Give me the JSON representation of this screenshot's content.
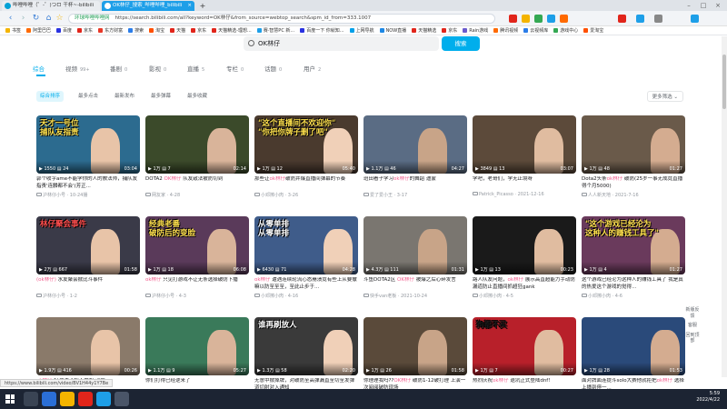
{
  "browser": {
    "tabs": [
      {
        "label": "哔哩哔哩（゜-゜)つロ 干杯~-bilibili",
        "active": false
      },
      {
        "label": "OK林仔_搜索_哔哩哔哩_bilibili",
        "active": true
      }
    ],
    "new_tab_symbol": "+",
    "address": {
      "site_label": "环球哔哩哔哩网",
      "url": "https://search.bilibili.com/all?keyword=OK林仔&from_source=webtop_search&spm_id_from=333.1007"
    },
    "bookmarks": [
      {
        "label": "书签",
        "color": "#f4b400"
      },
      {
        "label": "阿里巴巴",
        "color": "#ff6a00"
      },
      {
        "label": "百度",
        "color": "#2932e1"
      },
      {
        "label": "京东",
        "color": "#e1251b"
      },
      {
        "label": "东方财富",
        "color": "#e83828"
      },
      {
        "label": "搜索",
        "color": "#2b7de9"
      },
      {
        "label": "淘宝",
        "color": "#ff5000"
      },
      {
        "label": "天猫",
        "color": "#e1251b"
      },
      {
        "label": "京东",
        "color": "#e1251b"
      },
      {
        "label": "天猫精选-理想...",
        "color": "#e1251b"
      },
      {
        "label": "赛·智慧PC 新...",
        "color": "#1e9fe8"
      },
      {
        "label": "百度一下 你就知...",
        "color": "#2932e1"
      },
      {
        "label": "上网导航",
        "color": "#00a0e9"
      },
      {
        "label": "NOW直播",
        "color": "#1e88e5"
      },
      {
        "label": "天猫精选",
        "color": "#e1251b"
      },
      {
        "label": "京东",
        "color": "#e1251b"
      },
      {
        "label": "Rain游戏",
        "color": "#6a5acd"
      },
      {
        "label": "腾讯视频",
        "color": "#ff6a00"
      },
      {
        "label": "云视频库",
        "color": "#2b7de9"
      },
      {
        "label": "游戏中心",
        "color": "#34a853"
      },
      {
        "label": "爱淘宝",
        "color": "#ff5000"
      }
    ],
    "status_url": "https://www.bilibili.com/video/BV1H44y1Y7Be"
  },
  "search": {
    "query": "OK林仔",
    "button_label": "搜索"
  },
  "type_tabs": [
    {
      "label": "综合",
      "count": "",
      "active": true
    },
    {
      "label": "视频",
      "count": "99+",
      "active": false
    },
    {
      "label": "番剧",
      "count": "0",
      "active": false
    },
    {
      "label": "影视",
      "count": "0",
      "active": false
    },
    {
      "label": "直播",
      "count": "5",
      "active": false
    },
    {
      "label": "专栏",
      "count": "0",
      "active": false
    },
    {
      "label": "话题",
      "count": "0",
      "active": false
    },
    {
      "label": "用户",
      "count": "2",
      "active": false
    }
  ],
  "sort_options": [
    {
      "label": "综合排序",
      "active": true
    },
    {
      "label": "最多点击",
      "active": false
    },
    {
      "label": "最新发布",
      "active": false
    },
    {
      "label": "最多弹幕",
      "active": false
    },
    {
      "label": "最多收藏",
      "active": false
    }
  ],
  "more_filter_label": "更多筛选",
  "videos": [
    {
      "title_pre": "郭个收字ame不能学你的人的教法师，捕队友指责'连麟都不会'(芳正...",
      "hl": "",
      "title_post": "",
      "author": "沪林仔小号",
      "date": "10-24播",
      "views": "1550",
      "danmaku": "24",
      "duration": "03:04",
      "caption": "天才一号位\n捕队友指责",
      "bg": "#2c6b8f",
      "cap_color": "#ffe14d"
    },
    {
      "title_pre": "DOTA2 ",
      "hl": "OK林仔",
      "title_post": " 队友敌法被防切到",
      "author": "网友家",
      "date": "4-28",
      "views": "1万",
      "danmaku": "7",
      "duration": "02:14",
      "caption": "",
      "bg": "#3b4a2a",
      "cap_color": "#fff"
    },
    {
      "title_pre": "那些让",
      "hl": "ok林仔",
      "title_post": "破防并爆直播间弹幕的节奏",
      "author": "小邓擦小肉",
      "date": "3-26",
      "views": "1万",
      "danmaku": "12",
      "duration": "05:40",
      "caption": "\"这个直播间不欢迎你\"\n\"你把你牌子删了吧\"",
      "bg": "#4a3a2e",
      "cap_color": "#ffe14d"
    },
    {
      "title_pre": "班田看子学习",
      "hl": "ok林仔",
      "title_post": "的舞蹈 迪蒙",
      "author": "爱了爱小王",
      "date": "3-17",
      "views": "1.1万",
      "danmaku": "46",
      "duration": "04:27",
      "caption": "",
      "bg": "#5a6c84",
      "cap_color": "#fff"
    },
    {
      "title_pre": "学吧，老哥们，学无止境呀",
      "hl": "",
      "title_post": "",
      "author": "Patrick_Picasso",
      "date": "2021-12-16",
      "views": "3849",
      "danmaku": "13",
      "duration": "03:07",
      "caption": "",
      "bg": "#5c4a3a",
      "cap_color": "#fff"
    },
    {
      "title_pre": "Dota2头条",
      "hl": "ok林仔",
      "title_post": " 破防(25岁一事无成竟直播得个月5000)",
      "author": "人人新天地",
      "date": "2021-7-16",
      "views": "1万",
      "danmaku": "48",
      "duration": "01:27",
      "caption": "",
      "bg": "#6a5a4a",
      "cap_color": "#fff"
    },
    {
      "title_pre": "",
      "hl": "(ok林仔)",
      "title_post": " 水友聚会掀比斗事件",
      "author": "沪林仔小号",
      "date": "1-2",
      "views": "2万",
      "danmaku": "667",
      "duration": "01:58",
      "caption": "林仔聚会事件",
      "bg": "#3a3a48",
      "cap_color": "#ff4d4d"
    },
    {
      "title_pre": "",
      "hl": "ok林仔",
      "title_post": " 只见打游戏不让无条选择破防下播",
      "author": "沪林仔小号",
      "date": "4-3",
      "views": "1万",
      "danmaku": "18",
      "duration": "06:08",
      "caption": "经典老番\n破防后的变脸",
      "bg": "#5a3a5a",
      "cap_color": "#ffe14d"
    },
    {
      "title_pre": "",
      "hl": "ok林仔",
      "title_post": " 遭遇连续轮流心态崩溃竟有些上从要撒嘛以防至至至，至此止步于...",
      "author": "小邓擦小肉",
      "date": "4-16",
      "views": "6430",
      "danmaku": "71",
      "duration": "04:28",
      "caption": "从零单排\n从零单排",
      "bg": "#3f5c8a",
      "cap_color": "#fff"
    },
    {
      "title_pre": "斗鱼DOTA2区 ",
      "hl": "OK林仔",
      "title_post": " 被爆之后心碎发言",
      "author": "快手van老板",
      "date": "2021-10-24",
      "views": "4.3万",
      "danmaku": "111",
      "duration": "01:31",
      "caption": "",
      "bg": "#7a7670",
      "cap_color": "#fff"
    },
    {
      "title_pre": "路人队友问题，",
      "hl": "ok林仔",
      "title_post": " 展示高直超能力手动防漏道防止直播间抓超狂gank",
      "author": "小邓擦小肉",
      "date": "4-5",
      "views": "1万",
      "danmaku": "13",
      "duration": "00:23",
      "caption": "",
      "bg": "#1a1a1a",
      "cap_color": "#fff"
    },
    {
      "title_pre": "这个游戏已经沦为这种人的赚钱工具了 我是真的热爱这个游戏的觉得...",
      "hl": "",
      "title_post": "",
      "author": "小邓擦小肉",
      "date": "4-6",
      "views": "1万",
      "danmaku": "4",
      "duration": "01:27",
      "caption": "\"这个游戏已经沦为\n这种人的赚钱工具了\"",
      "bg": "#6a3a5c",
      "cap_color": "#ffe14d"
    },
    {
      "title_pre": "",
      "hl": "ok林仔",
      "title_post": " 打游戏子和不然和 浮躁",
      "author": "沪林仔小号",
      "date": "4-12",
      "views": "1.9万",
      "danmaku": "416",
      "duration": "00:26",
      "caption": "",
      "bg": "#8a7a6a",
      "cap_color": "#fff"
    },
    {
      "title_pre": "你们打得已经逆来了",
      "hl": "",
      "title_post": "",
      "author": "沪林仔小号",
      "date": "4-20",
      "views": "1.1万",
      "danmaku": "9",
      "duration": "05:27",
      "caption": "",
      "bg": "#3a7a5a",
      "cap_color": "#fff"
    },
    {
      "title_pre": "无意中掀掉牌，对破防至高弹漏直至切至发弹道切射对入通知",
      "hl": "",
      "title_post": "",
      "author": "小邓擦小肉",
      "date": "4-17",
      "views": "1.3万",
      "danmaku": "58",
      "duration": "02:20",
      "caption": "谁再刷放人",
      "bg": "#3a3a3a",
      "cap_color": "#fff"
    },
    {
      "title_pre": "你理理我吗??",
      "hl": "OK林仔",
      "title_post": " 破防1-12破打理 上演一次阅阅破防现场",
      "author": "小邓擦小肉",
      "date": "4-6",
      "views": "1万",
      "danmaku": "26",
      "duration": "01:58",
      "caption": "",
      "bg": "#5a4a3a",
      "cap_color": "#fff"
    },
    {
      "title_pre": "热烈庆祝",
      "hl": "ok林仔",
      "title_post": " 退坑正式登陆dnf！",
      "author": "沪林仔小号",
      "date": "4-16",
      "views": "1万",
      "danmaku": "7",
      "duration": "00:27",
      "caption": "狗都不买",
      "bg": "#b8202a",
      "cap_color": "#1a1a1a"
    },
    {
      "title_pre": "面对牌面连提斗solo大赛他就拒把",
      "hl": "ok林仔",
      "title_post": " 选择上播到停一...",
      "author": "沪林仔小号",
      "date": "4-1",
      "views": "1万",
      "danmaku": "28",
      "duration": "01:53",
      "caption": "",
      "bg": "#2a4a7a",
      "cap_color": "#fff"
    }
  ],
  "side_buttons": [
    "新版反馈",
    "客服",
    "回到顶部"
  ],
  "taskbar": {
    "time": "5:59",
    "date": "2022/4/22"
  }
}
